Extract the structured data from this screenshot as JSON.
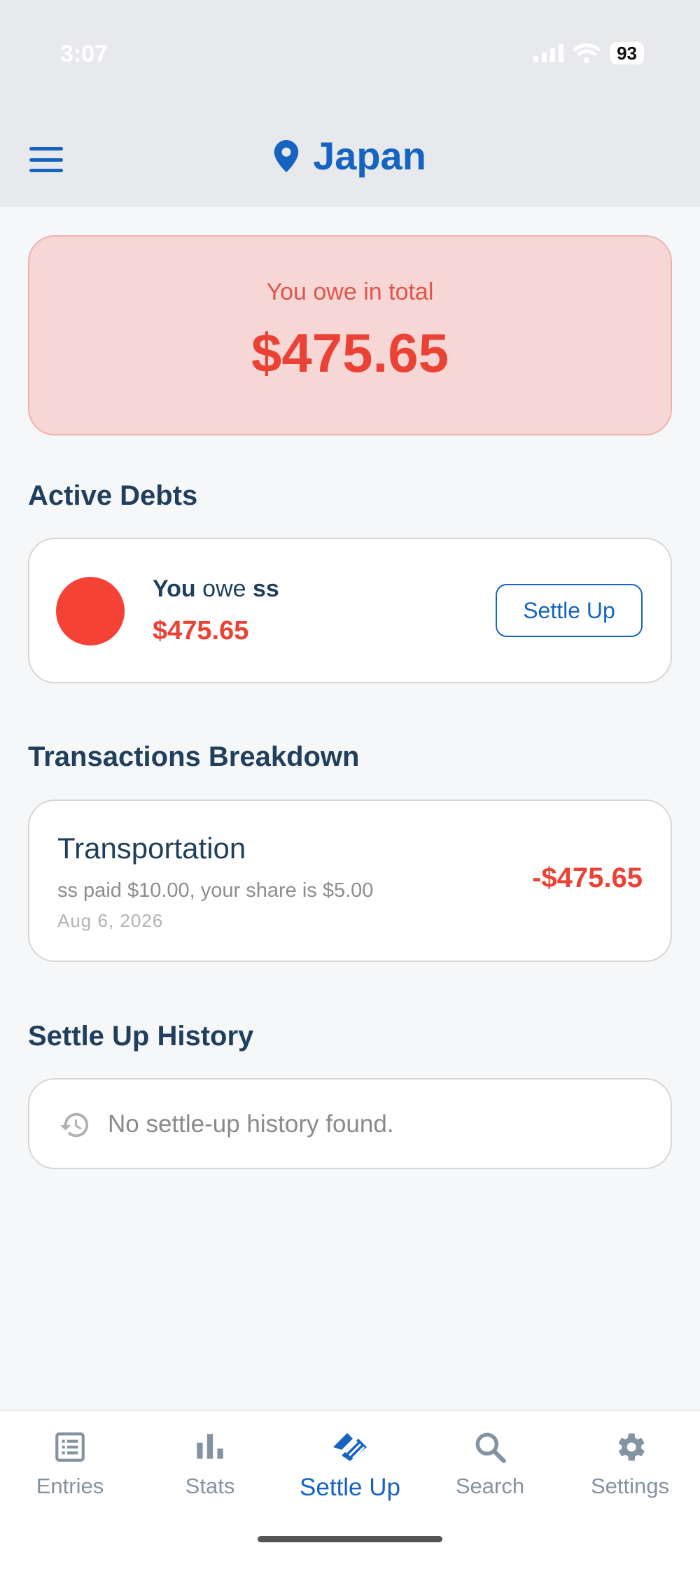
{
  "status_bar": {
    "time": "3:07",
    "battery": "93"
  },
  "header": {
    "title": "Japan"
  },
  "summary": {
    "label": "You owe in total",
    "amount": "$475.65"
  },
  "active_debts": {
    "title": "Active Debts",
    "items": [
      {
        "prefix": "You",
        "verb": "owe",
        "person": "ss",
        "amount": "$475.65",
        "button_label": "Settle Up",
        "avatar_color": "#f44336"
      }
    ]
  },
  "transactions": {
    "title": "Transactions Breakdown",
    "items": [
      {
        "category": "Transportation",
        "detail": "ss paid $10.00, your share is $5.00",
        "date": "Aug 6, 2026",
        "amount": "-$475.65"
      }
    ]
  },
  "history": {
    "title": "Settle Up History",
    "empty_text": "No settle-up history found."
  },
  "nav": {
    "items": [
      {
        "label": "Entries",
        "icon": "entries-icon"
      },
      {
        "label": "Stats",
        "icon": "bar-chart-icon"
      },
      {
        "label": "Settle Up",
        "icon": "handshake-icon",
        "active": true
      },
      {
        "label": "Search",
        "icon": "search-icon"
      },
      {
        "label": "Settings",
        "icon": "gear-icon"
      }
    ]
  },
  "colors": {
    "accent": "#1565c0",
    "debt": "#ea4335",
    "title": "#1f3f5c"
  }
}
